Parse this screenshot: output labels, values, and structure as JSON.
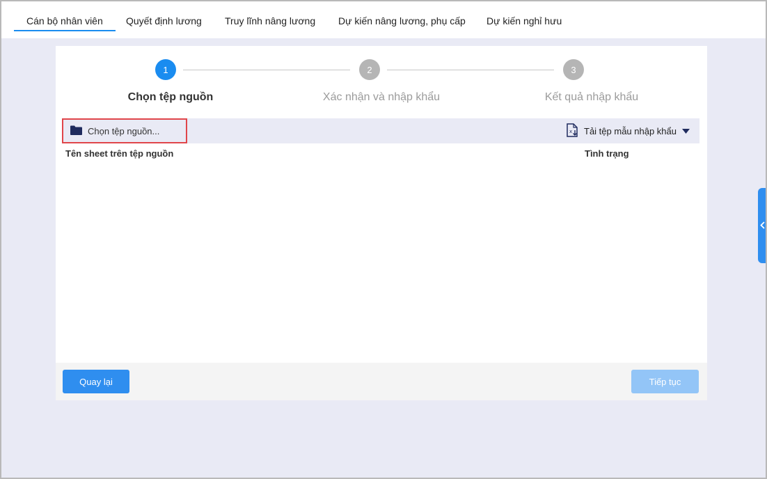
{
  "tabs": [
    {
      "label": "Cán bộ nhân viên",
      "active": true
    },
    {
      "label": "Quyết định lương",
      "active": false
    },
    {
      "label": "Truy lĩnh nâng lương",
      "active": false
    },
    {
      "label": "Dự kiến nâng lương, phụ cấp",
      "active": false
    },
    {
      "label": "Dự kiến nghỉ hưu",
      "active": false
    }
  ],
  "steps": [
    {
      "number": "1",
      "label": "Chọn tệp nguồn",
      "state": "active"
    },
    {
      "number": "2",
      "label": "Xác nhận và nhập khẩu",
      "state": "inactive"
    },
    {
      "number": "3",
      "label": "Kết quả nhập khẩu",
      "state": "inactive"
    }
  ],
  "toolbar": {
    "choose_file_label": "Chọn tệp nguồn...",
    "download_template_label": "Tải tệp mẫu nhập khẩu"
  },
  "table": {
    "columns": [
      "Tên sheet trên tệp nguồn",
      "Tình trạng"
    ]
  },
  "footer": {
    "back_label": "Quay lại",
    "next_label": "Tiếp tục"
  },
  "colors": {
    "accent": "#1a8cf0",
    "step_inactive": "#b5b5b5",
    "highlight_border": "#e0454a",
    "next_disabled": "#93c5f7",
    "folder_icon": "#1f2b5e"
  },
  "icons": {
    "choose_file": "folder-icon",
    "template": "excel-file-download-icon",
    "dropdown": "caret-down-icon",
    "side_handle": "chevron-left-icon"
  }
}
